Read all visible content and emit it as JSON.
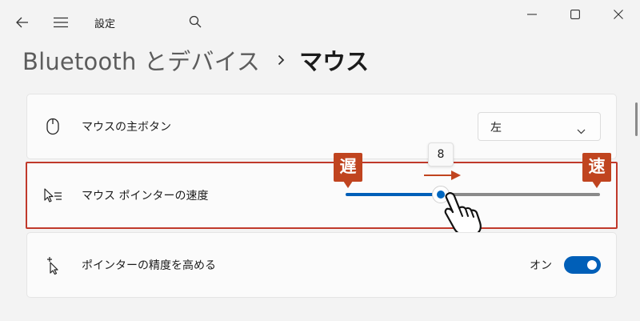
{
  "window": {
    "app_title": "設定",
    "icons": [
      "back-arrow-icon",
      "hamburger-menu-icon",
      "search-icon",
      "minimize-icon",
      "maximize-icon",
      "close-icon"
    ]
  },
  "breadcrumb": {
    "parent": "Bluetooth とデバイス",
    "separator_icon": "chevron-right-icon",
    "current": "マウス"
  },
  "settings": {
    "primary_button": {
      "label": "マウスの主ボタン",
      "icon": "mouse-icon",
      "selected_value": "左"
    },
    "pointer_speed": {
      "label": "マウス ポインターの速度",
      "icon": "pointer-speed-icon",
      "value": "8",
      "fraction": 0.375,
      "slow_badge": "遅",
      "fast_badge": "速"
    },
    "enhance_precision": {
      "label": "ポインターの精度を高める",
      "icon": "precision-pointer-icon",
      "toggle_state_label": "オン",
      "is_on": true
    }
  },
  "colors": {
    "accent": "#005fb8",
    "highlight_border": "#c0392b",
    "badge": "#c0441f"
  }
}
